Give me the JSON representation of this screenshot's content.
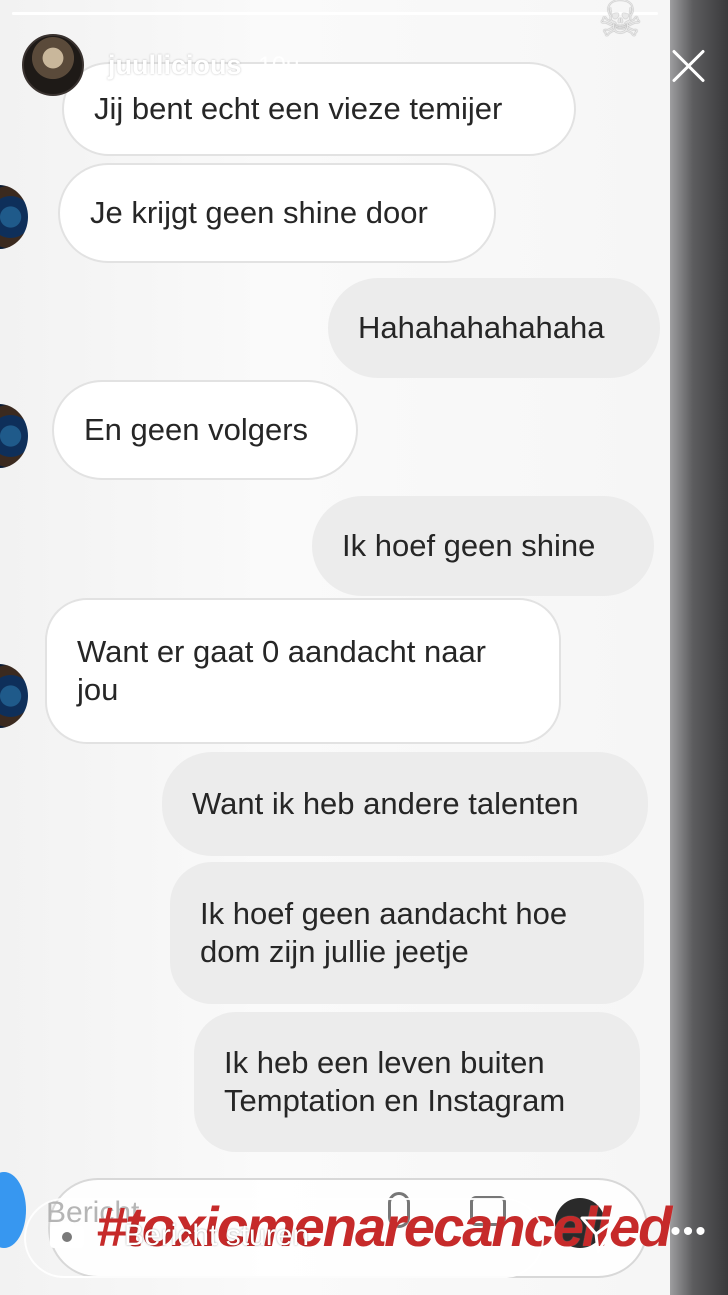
{
  "story": {
    "username": "juullicious",
    "timestamp": "10u",
    "progress": 1.0
  },
  "icons": {
    "sticker": "skull-crossbones-icon",
    "close": "close-icon",
    "camera": "camera-icon",
    "send": "send-icon",
    "more": "more-icon"
  },
  "messages": [
    {
      "direction": "in",
      "text": "Jij bent echt een vieze temijer"
    },
    {
      "direction": "in",
      "text": "Je krijgt geen shine door"
    },
    {
      "direction": "out",
      "text": "Hahahahahahaha"
    },
    {
      "direction": "in",
      "text": "En geen volgers"
    },
    {
      "direction": "out",
      "text": "Ik hoef geen shine"
    },
    {
      "direction": "in",
      "text": "Want er gaat 0 aandacht naar jou"
    },
    {
      "direction": "out",
      "text": "Want ik heb andere talenten"
    },
    {
      "direction": "out",
      "text": "Ik hoef geen aandacht hoe dom zijn jullie jeetje"
    },
    {
      "direction": "out",
      "text": "Ik heb een leven buiten Temptation en Instagram"
    }
  ],
  "composer": {
    "placeholder": "Bericht"
  },
  "overlay": {
    "hashtag": "#toxicmenarecancelled",
    "hashtag_color": "#c62a2a"
  },
  "reply": {
    "placeholder": "Bericht sturen"
  },
  "more_label": "•••"
}
